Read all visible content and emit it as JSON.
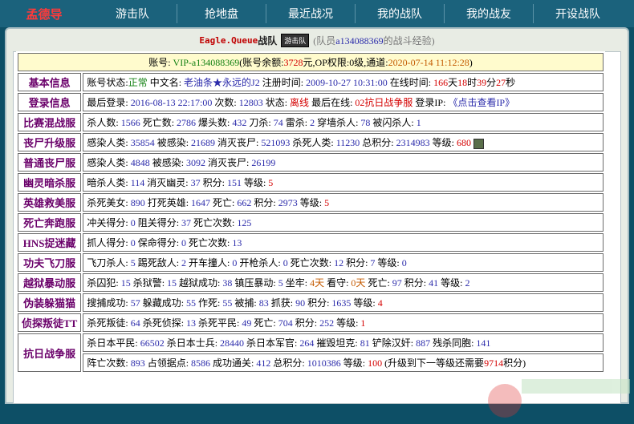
{
  "nav": {
    "logo": "孟德导",
    "items": [
      "游击队",
      "抢地盘",
      "最近战况",
      "我的战队",
      "我的战友",
      "开设战队"
    ]
  },
  "header": {
    "team_name": "Eagle.Queue",
    "team_suffix": "战队",
    "badge": "游击队",
    "sub_pre": "(队员",
    "member": "a134088369",
    "sub_post": "的战斗经验)"
  },
  "account": {
    "label": "账号:",
    "vip": "VIP-a134088369",
    "bal_pre": "(账号余额:",
    "balance": "3728",
    "bal_post": "元,OP权限:",
    "op": "0级,通道:",
    "datetime": "2020-07-14 11:12:28",
    ")": ")"
  },
  "rows": {
    "basic": {
      "label": "基本信息",
      "p": [
        [
          "账号状态:",
          ""
        ],
        [
          "正常",
          "g"
        ],
        [
          " 中文名: ",
          ""
        ],
        [
          "老油条★永远的J2",
          "n"
        ],
        [
          " 注册时间: ",
          ""
        ],
        [
          "2009-10-27 10:31:00",
          "n"
        ],
        [
          " 在线时间: ",
          ""
        ],
        [
          "166",
          "r"
        ],
        [
          "天",
          ""
        ],
        [
          "18",
          "r"
        ],
        [
          "时",
          ""
        ],
        [
          "39",
          "r"
        ],
        [
          "分",
          ""
        ],
        [
          "27",
          "r"
        ],
        [
          "秒",
          ""
        ]
      ]
    },
    "login": {
      "label": "登录信息",
      "p": [
        [
          "最后登录: ",
          ""
        ],
        [
          "2016-08-13 22:17:00",
          "n"
        ],
        [
          " 次数: ",
          ""
        ],
        [
          "12803",
          "n"
        ],
        [
          " 状态: ",
          ""
        ],
        [
          "离线",
          "r"
        ],
        [
          " 最后在线: ",
          ""
        ],
        [
          "02抗日战争服",
          "r"
        ],
        [
          " 登录IP: ",
          ""
        ],
        [
          "《点击查看IP》",
          "n"
        ]
      ]
    },
    "match": {
      "label": "比赛混战服",
      "p": [
        [
          "杀人数: ",
          ""
        ],
        [
          "1566",
          "n"
        ],
        [
          " 死亡数: ",
          ""
        ],
        [
          "2786",
          "n"
        ],
        [
          " 爆头数: ",
          ""
        ],
        [
          "432",
          "n"
        ],
        [
          " 刀杀: ",
          ""
        ],
        [
          "74",
          "n"
        ],
        [
          " 雷杀: ",
          ""
        ],
        [
          "2",
          "n"
        ],
        [
          " 穿墙杀人: ",
          ""
        ],
        [
          "78",
          "n"
        ],
        [
          " 被闪杀人: ",
          ""
        ],
        [
          "1",
          "n"
        ]
      ]
    },
    "zombie": {
      "label": "丧尸升级服",
      "p": [
        [
          "感染人类: ",
          ""
        ],
        [
          "35854",
          "n"
        ],
        [
          " 被感染: ",
          ""
        ],
        [
          "21689",
          "n"
        ],
        [
          " 消灭丧尸: ",
          ""
        ],
        [
          "521093",
          "n"
        ],
        [
          " 杀死人类: ",
          ""
        ],
        [
          "11230",
          "n"
        ],
        [
          " 总积分: ",
          ""
        ],
        [
          "2314983",
          "n"
        ],
        [
          " 等级: ",
          ""
        ],
        [
          "680",
          "r"
        ]
      ]
    },
    "normal": {
      "label": "普通丧尸服",
      "p": [
        [
          "感染人类: ",
          ""
        ],
        [
          "4848",
          "n"
        ],
        [
          " 被感染: ",
          ""
        ],
        [
          "3092",
          "n"
        ],
        [
          " 消灭丧尸: ",
          ""
        ],
        [
          "26199",
          "n"
        ]
      ]
    },
    "ghost": {
      "label": "幽灵暗杀服",
      "p": [
        [
          "暗杀人类: ",
          ""
        ],
        [
          "114",
          "n"
        ],
        [
          " 消灭幽灵: ",
          ""
        ],
        [
          "37",
          "n"
        ],
        [
          " 积分: ",
          ""
        ],
        [
          "151",
          "n"
        ],
        [
          " 等级: ",
          ""
        ],
        [
          "5",
          "r"
        ]
      ]
    },
    "hero": {
      "label": "英雄救美服",
      "p": [
        [
          "杀死美女: ",
          ""
        ],
        [
          "890",
          "n"
        ],
        [
          " 打死英雄: ",
          ""
        ],
        [
          "1647",
          "n"
        ],
        [
          " 死亡: ",
          ""
        ],
        [
          "662",
          "n"
        ],
        [
          " 积分: ",
          ""
        ],
        [
          "2973",
          "n"
        ],
        [
          " 等级: ",
          ""
        ],
        [
          "5",
          "r"
        ]
      ]
    },
    "run": {
      "label": "死亡奔跑服",
      "p": [
        [
          "冲关得分: ",
          ""
        ],
        [
          "0",
          "n"
        ],
        [
          " 阻关得分: ",
          ""
        ],
        [
          "37",
          "n"
        ],
        [
          " 死亡次数: ",
          ""
        ],
        [
          "125",
          "n"
        ]
      ]
    },
    "hns": {
      "label": "HNS捉迷藏",
      "p": [
        [
          "抓人得分: ",
          ""
        ],
        [
          "0",
          "n"
        ],
        [
          " 保命得分: ",
          ""
        ],
        [
          "0",
          "n"
        ],
        [
          " 死亡次数: ",
          ""
        ],
        [
          "13",
          "n"
        ]
      ]
    },
    "kungfu": {
      "label": "功夫飞刀服",
      "p": [
        [
          "飞刀杀人: ",
          ""
        ],
        [
          "5",
          "n"
        ],
        [
          " 踢死敌人: ",
          ""
        ],
        [
          "2",
          "n"
        ],
        [
          " 开车撞人: ",
          ""
        ],
        [
          "0",
          "n"
        ],
        [
          " 开枪杀人: ",
          ""
        ],
        [
          "0",
          "n"
        ],
        [
          " 死亡次数: ",
          ""
        ],
        [
          "12",
          "n"
        ],
        [
          " 积分: ",
          ""
        ],
        [
          "7",
          "n"
        ],
        [
          " 等级: ",
          ""
        ],
        [
          "0",
          "n"
        ]
      ]
    },
    "jail": {
      "label": "越狱暴动服",
      "p": [
        [
          "杀囚犯: ",
          ""
        ],
        [
          "15",
          "n"
        ],
        [
          " 杀狱警: ",
          ""
        ],
        [
          "15",
          "n"
        ],
        [
          " 越狱成功: ",
          ""
        ],
        [
          "38",
          "n"
        ],
        [
          " 镇压暴动: ",
          ""
        ],
        [
          "5",
          "n"
        ],
        [
          " 坐牢: ",
          ""
        ],
        [
          "4天",
          "o"
        ],
        [
          " 看守: ",
          ""
        ],
        [
          "0天",
          "o"
        ],
        [
          " 死亡: ",
          ""
        ],
        [
          "97",
          "n"
        ],
        [
          " 积分: ",
          ""
        ],
        [
          "41",
          "n"
        ],
        [
          " 等级: ",
          ""
        ],
        [
          "2",
          "n"
        ]
      ]
    },
    "disguise": {
      "label": "伪装躲猫猫",
      "p": [
        [
          "搜捕成功: ",
          ""
        ],
        [
          "57",
          "n"
        ],
        [
          " 躲藏成功: ",
          ""
        ],
        [
          "55",
          "n"
        ],
        [
          " 作死: ",
          ""
        ],
        [
          "55",
          "n"
        ],
        [
          " 被捕: ",
          ""
        ],
        [
          "83",
          "n"
        ],
        [
          " 抓获: ",
          ""
        ],
        [
          "90",
          "n"
        ],
        [
          " 积分: ",
          ""
        ],
        [
          "1635",
          "n"
        ],
        [
          " 等级: ",
          ""
        ],
        [
          "4",
          "r"
        ]
      ]
    },
    "rebel": {
      "label": "侦探叛徒TT",
      "p": [
        [
          "杀死叛徒: ",
          ""
        ],
        [
          "64",
          "n"
        ],
        [
          " 杀死侦探: ",
          ""
        ],
        [
          "13",
          "n"
        ],
        [
          " 杀死平民: ",
          ""
        ],
        [
          "49",
          "n"
        ],
        [
          " 死亡: ",
          ""
        ],
        [
          "704",
          "n"
        ],
        [
          " 积分: ",
          ""
        ],
        [
          "252",
          "n"
        ],
        [
          " 等级: ",
          ""
        ],
        [
          "1",
          "r"
        ]
      ]
    },
    "war1": {
      "label": "抗日战争服",
      "p": [
        [
          "杀日本平民: ",
          ""
        ],
        [
          "66502",
          "n"
        ],
        [
          " 杀日本士兵: ",
          ""
        ],
        [
          "28440",
          "n"
        ],
        [
          " 杀日本军官: ",
          ""
        ],
        [
          "264",
          "n"
        ],
        [
          " 摧毁坦克: ",
          ""
        ],
        [
          "81",
          "n"
        ],
        [
          " 铲除汉奸: ",
          ""
        ],
        [
          "887",
          "n"
        ],
        [
          " 残杀同胞: ",
          ""
        ],
        [
          "141",
          "n"
        ]
      ]
    },
    "war2": {
      "p": [
        [
          "阵亡次数: ",
          ""
        ],
        [
          "893",
          "n"
        ],
        [
          " 占领据点: ",
          ""
        ],
        [
          "8586",
          "n"
        ],
        [
          " 成功通关: ",
          ""
        ],
        [
          "412",
          "n"
        ],
        [
          " 总积分: ",
          ""
        ],
        [
          "1010386",
          "n"
        ],
        [
          " 等级: ",
          ""
        ],
        [
          "100",
          "r"
        ],
        [
          " (升级到下一等级还需要",
          ""
        ],
        [
          "9714",
          "r"
        ],
        [
          "积分)",
          ""
        ]
      ]
    }
  }
}
